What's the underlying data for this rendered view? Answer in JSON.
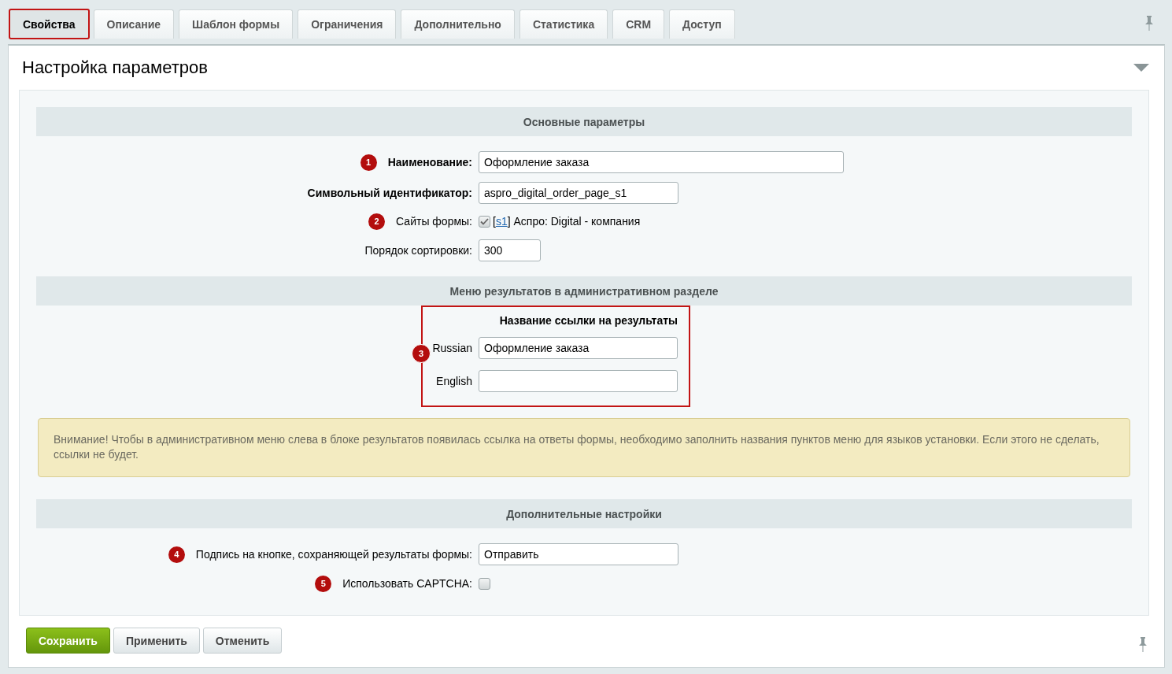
{
  "tabs": [
    {
      "label": "Свойства",
      "selected": true,
      "highlighted": true
    },
    {
      "label": "Описание",
      "selected": false,
      "highlighted": false
    },
    {
      "label": "Шаблон формы",
      "selected": false,
      "highlighted": false
    },
    {
      "label": "Ограничения",
      "selected": false,
      "highlighted": false
    },
    {
      "label": "Дополнительно",
      "selected": false,
      "highlighted": false
    },
    {
      "label": "Статистика",
      "selected": false,
      "highlighted": false
    },
    {
      "label": "CRM",
      "selected": false,
      "highlighted": false
    },
    {
      "label": "Доступ",
      "selected": false,
      "highlighted": false
    }
  ],
  "panel": {
    "title": "Настройка параметров",
    "expanded": true
  },
  "sections": [
    {
      "heading": "Основные параметры",
      "rows": [
        {
          "kind": "wide",
          "badge": "1",
          "label": "Наименование:",
          "required": true,
          "value": "Оформление заказа"
        },
        {
          "kind": "medium",
          "label": "Символьный идентификатор:",
          "required": true,
          "value": "aspro_digital_order_page_s1"
        },
        {
          "kind": "sites",
          "badge": "2",
          "label": "Сайты формы:",
          "required": false,
          "checked": true,
          "prefix": "[",
          "link": "s1",
          "suffix": "] Аспро: Digital - компания"
        },
        {
          "kind": "short",
          "label": "Порядок сортировки:",
          "required": false,
          "value": "300"
        }
      ]
    },
    {
      "heading": "Меню результатов в административном разделе",
      "group": {
        "title": "Название ссылки на результаты",
        "badge": "3",
        "highlighted": true,
        "rows": [
          {
            "label": "Russian",
            "value": "Оформление заказа"
          },
          {
            "label": "English"
          }
        ]
      },
      "note": "Внимание! Чтобы в административном меню слева в блоке результатов появилась ссылка на ответы формы, необходимо заполнить названия пунктов меню для языков установки. Если этого не сделать, ссылки не будет."
    },
    {
      "heading": "Дополнительные настройки",
      "rows": [
        {
          "kind": "medium",
          "badge": "4",
          "label": "Подпись на кнопке, сохраняющей результаты формы:",
          "required": false,
          "value": "Отправить"
        },
        {
          "kind": "checkbox",
          "badge": "5",
          "label": "Использовать CAPTCHA:",
          "required": false,
          "checked": false
        }
      ]
    }
  ],
  "buttons": [
    {
      "label": "Сохранить",
      "kind": "primary"
    },
    {
      "label": "Применить",
      "kind": "normal"
    },
    {
      "label": "Отменить",
      "kind": "normal"
    }
  ]
}
